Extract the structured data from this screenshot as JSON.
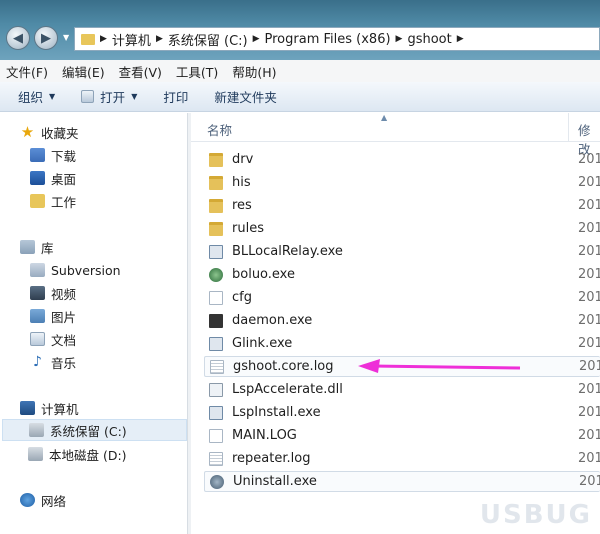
{
  "address": {
    "crumbs": [
      "计算机",
      "系统保留 (C:)",
      "Program Files (x86)",
      "gshoot"
    ]
  },
  "menu": [
    "文件(F)",
    "编辑(E)",
    "查看(V)",
    "工具(T)",
    "帮助(H)"
  ],
  "toolbar": {
    "organize": "组织",
    "open": "打开",
    "print": "打印",
    "new_folder": "新建文件夹"
  },
  "sidebar": {
    "favorites": "收藏夹",
    "downloads": "下载",
    "desktop": "桌面",
    "work": "工作",
    "libraries": "库",
    "subversion": "Subversion",
    "videos": "视频",
    "pictures": "图片",
    "documents": "文档",
    "music": "音乐",
    "computer": "计算机",
    "drive_c": "系统保留 (C:)",
    "drive_d": "本地磁盘 (D:)",
    "network": "网络"
  },
  "list": {
    "col_name": "名称",
    "col_modified": "修改",
    "files": [
      {
        "name": "drv",
        "date": "201"
      },
      {
        "name": "his",
        "date": "201"
      },
      {
        "name": "res",
        "date": "201"
      },
      {
        "name": "rules",
        "date": "201"
      },
      {
        "name": "BLLocalRelay.exe",
        "date": "201"
      },
      {
        "name": "boluo.exe",
        "date": "201"
      },
      {
        "name": "cfg",
        "date": "201"
      },
      {
        "name": "daemon.exe",
        "date": "201"
      },
      {
        "name": "Glink.exe",
        "date": "201"
      },
      {
        "name": "gshoot.core.log",
        "date": "201"
      },
      {
        "name": "LspAccelerate.dll",
        "date": "201"
      },
      {
        "name": "LspInstall.exe",
        "date": "201"
      },
      {
        "name": "MAIN.LOG",
        "date": "201"
      },
      {
        "name": "repeater.log",
        "date": "201"
      },
      {
        "name": "Uninstall.exe",
        "date": "201"
      }
    ]
  },
  "colors": {
    "annotation_arrow": "#ee2fd8",
    "selection": "#e5eef7"
  },
  "watermark": "USBUG"
}
